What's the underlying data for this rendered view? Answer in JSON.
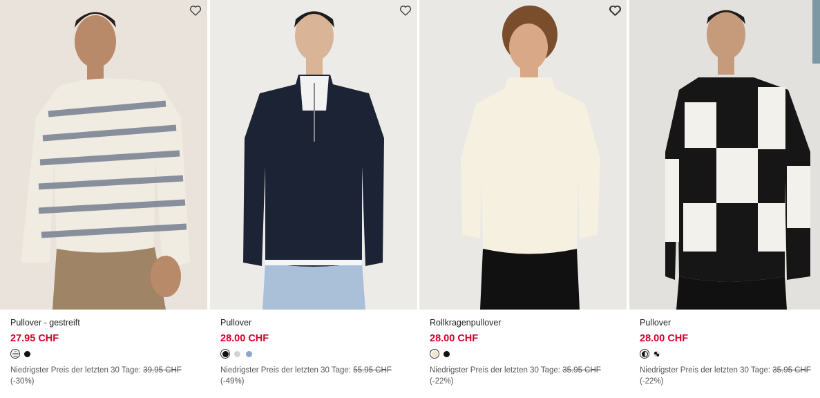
{
  "products": [
    {
      "name": "Pullover - gestreift",
      "price": "27.95 CHF",
      "swatches": [
        {
          "color": "striped-grey-white",
          "selected": true
        },
        {
          "color": "#111111",
          "selected": false
        }
      ],
      "lowest_label": "Niedrigster Preis der letzten 30 Tage:",
      "old_price": "39.95 CHF",
      "discount": "(-30%)",
      "favorite_icon": "heart-outline-icon"
    },
    {
      "name": "Pullover",
      "price": "28.00 CHF",
      "swatches": [
        {
          "color": "#111111",
          "selected": true
        },
        {
          "color": "#d2d3d6",
          "selected": false
        },
        {
          "color": "#8fa6c9",
          "selected": false
        }
      ],
      "lowest_label": "Niedrigster Preis der letzten 30 Tage:",
      "old_price": "55.95 CHF",
      "discount": "(-49%)",
      "favorite_icon": "heart-outline-icon"
    },
    {
      "name": "Rollkragenpullover",
      "price": "28.00 CHF",
      "swatches": [
        {
          "color": "#ece5cf",
          "selected": true
        },
        {
          "color": "#111111",
          "selected": false
        }
      ],
      "lowest_label": "Niedrigster Preis der letzten 30 Tage:",
      "old_price": "35.95 CHF",
      "discount": "(-22%)",
      "favorite_icon": "heart-outline-icon"
    },
    {
      "name": "Pullover",
      "price": "28.00 CHF",
      "swatches": [
        {
          "color": "black-white-split",
          "selected": true
        },
        {
          "color": "black-white-speckle",
          "selected": false
        }
      ],
      "lowest_label": "Niedrigster Preis der letzten 30 Tage:",
      "old_price": "35.95 CHF",
      "discount": "(-22%)",
      "favorite_icon": "heart-outline-icon"
    }
  ],
  "colors": {
    "sale_price": "#d4002a",
    "text": "#222222",
    "muted": "#555555"
  }
}
